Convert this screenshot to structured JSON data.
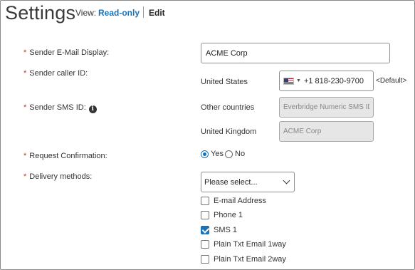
{
  "header": {
    "title": "Settings",
    "view_label": "View:",
    "read_only": "Read-only",
    "edit": "Edit"
  },
  "fields": {
    "sender_email": {
      "label": "Sender E-Mail Display:",
      "value": "ACME Corp"
    },
    "sender_caller_id": {
      "label": "Sender caller ID:",
      "country": "United States",
      "phone": "+1 818-230-9700",
      "default_tag": "<Default>"
    },
    "sender_sms_id": {
      "label": "Sender SMS ID:",
      "other_label": "Other countries",
      "other_value": "Everbridge Numeric SMS ID",
      "uk_label": "United Kingdom",
      "uk_value": "ACME Corp"
    },
    "request_confirmation": {
      "label": "Request Confirmation:",
      "yes": "Yes",
      "no": "No",
      "selected": "Yes"
    },
    "delivery_methods": {
      "label": "Delivery methods:",
      "placeholder": "Please select...",
      "options": [
        {
          "label": "E-mail Address",
          "checked": false
        },
        {
          "label": "Phone 1",
          "checked": false
        },
        {
          "label": "SMS 1",
          "checked": true
        },
        {
          "label": "Plain Txt Email 1way",
          "checked": false
        },
        {
          "label": "Plain Txt Email 2way",
          "checked": false
        }
      ]
    }
  },
  "required_marker": "*",
  "colors": {
    "accent": "#1a73b8",
    "required": "#c0392b"
  },
  "icons": {
    "info": "info-icon",
    "flag": "us-flag-icon"
  }
}
